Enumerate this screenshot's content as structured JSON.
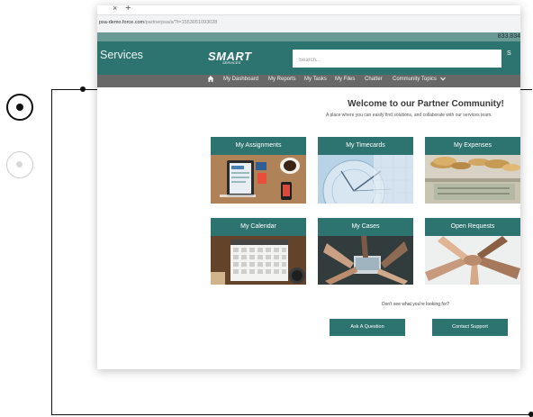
{
  "browser": {
    "tab_close_glyph": "×",
    "tab_new_glyph": "+",
    "url_host": "psa-demo.force.com",
    "url_path": "/partnerpsa/s/?t=1553051093028"
  },
  "top_counter": "833.834",
  "header": {
    "brand": "Services",
    "logo_text": "SMART",
    "logo_subtext": "SERVICES",
    "search_placeholder": "Search...",
    "search_button_label": "S"
  },
  "nav": {
    "items": [
      "My Dashboard",
      "My Reports",
      "My Tasks",
      "My Files",
      "Chatter",
      "Community Topics"
    ]
  },
  "main": {
    "welcome": "Welcome to our Partner Community!",
    "tagline": "A place where you can easily find solutions, and collaborate with our services team.",
    "tiles": [
      {
        "label": "My Assignments"
      },
      {
        "label": "My Timecards"
      },
      {
        "label": "My Expenses"
      },
      {
        "label": "My Calendar"
      },
      {
        "label": "My Cases"
      },
      {
        "label": "Open Requests"
      }
    ],
    "help_question": "Don't see what you're looking for?",
    "ask_button": "Ask A Question",
    "support_button": "Contact Support"
  },
  "colors": {
    "brand_teal": "#2d7470",
    "nav_gray": "#686868"
  }
}
